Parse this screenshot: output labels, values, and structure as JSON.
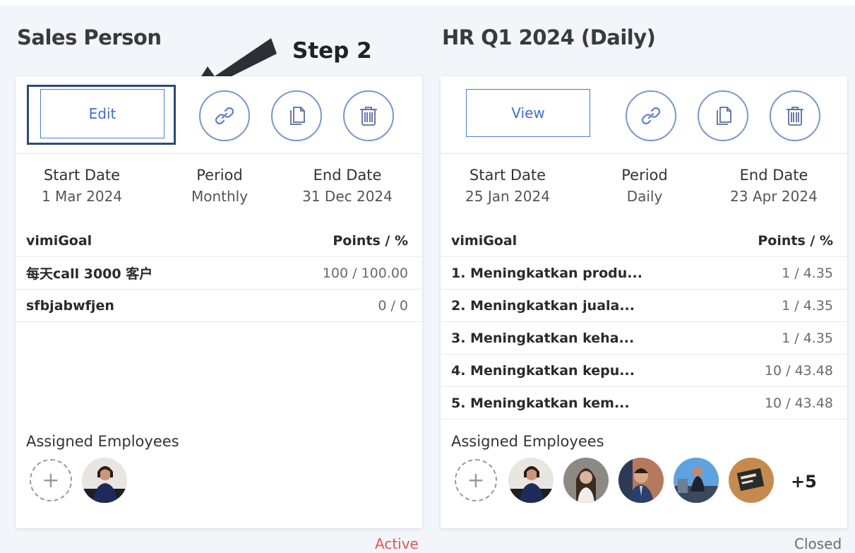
{
  "step_label": "Step 2",
  "colors": {
    "accent": "#3f6fce",
    "active": "#e05555",
    "closed": "#6b6b6b"
  },
  "cards": [
    {
      "title": "Sales Person",
      "primary_button": "Edit",
      "icons": [
        "link-icon",
        "copy-icon",
        "trash-icon"
      ],
      "dates": {
        "start_label": "Start Date",
        "start": "1 Mar 2024",
        "period_label": "Period",
        "period": "Monthly",
        "end_label": "End Date",
        "end": "31 Dec 2024"
      },
      "goal_header": "vimiGoal",
      "points_header": "Points / %",
      "goals": [
        {
          "name": "每天call 3000 客户",
          "points": "100 / 100.00"
        },
        {
          "name": "sfbjabwfjen",
          "points": "0 / 0"
        }
      ],
      "assigned_label": "Assigned Employees",
      "add_symbol": "+",
      "status": "Active"
    },
    {
      "title": "HR Q1 2024 (Daily)",
      "primary_button": "View",
      "icons": [
        "link-icon",
        "copy-icon",
        "trash-icon"
      ],
      "dates": {
        "start_label": "Start Date",
        "start": "25 Jan 2024",
        "period_label": "Period",
        "period": "Daily",
        "end_label": "End Date",
        "end": "23 Apr 2024"
      },
      "goal_header": "vimiGoal",
      "points_header": "Points / %",
      "goals": [
        {
          "name": "1. Meningkatkan produ...",
          "points": "1 / 4.35"
        },
        {
          "name": "2. Meningkatkan juala...",
          "points": "1 / 4.35"
        },
        {
          "name": "3. Meningkatkan keha...",
          "points": "1 / 4.35"
        },
        {
          "name": "4. Meningkatkan kepu...",
          "points": "10 / 43.48"
        },
        {
          "name": "5. Meningkatkan kem...",
          "points": "10 / 43.48"
        }
      ],
      "assigned_label": "Assigned Employees",
      "add_symbol": "+",
      "more_count": "+5",
      "status": "Closed"
    }
  ]
}
